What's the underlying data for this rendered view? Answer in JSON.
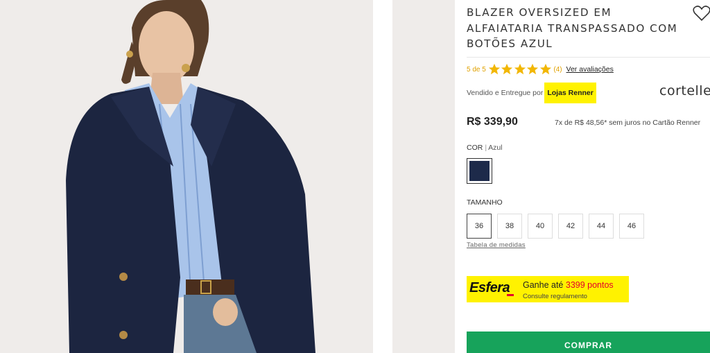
{
  "product": {
    "title": "BLAZER OVERSIZED EM ALFAIATARIA TRANSPASSADO COM BOTÕES AZUL",
    "favorite_icon": "heart-outline-icon"
  },
  "rating": {
    "score_text": "5 de 5",
    "stars": 5,
    "count_text": "(4)",
    "reviews_link": "Ver avaliações",
    "star_color": "#f2b705"
  },
  "seller": {
    "prefix": "Vendido e Entregue por",
    "store": "Lojas Renner",
    "highlight_color": "#fff200",
    "brand": "cortelle"
  },
  "pricing": {
    "price": "R$ 339,90",
    "installments": "7x de R$ 48,56* sem juros no Cartão Renner"
  },
  "color": {
    "label": "COR",
    "value": "Azul",
    "swatch_hex": "#1d2a4a"
  },
  "size": {
    "label": "TAMANHO",
    "options": [
      "36",
      "38",
      "40",
      "42",
      "44",
      "46"
    ],
    "selected": "36",
    "chart_link": "Tabela de medidas"
  },
  "loyalty": {
    "logo": "Esfera",
    "earn_prefix": "Ganhe até",
    "points": "3399 pontos",
    "rules": "Consulte regulamento",
    "accent": "#e3002b"
  },
  "actions": {
    "buy_label": "COMPRAR",
    "buy_color": "#17a35b"
  }
}
